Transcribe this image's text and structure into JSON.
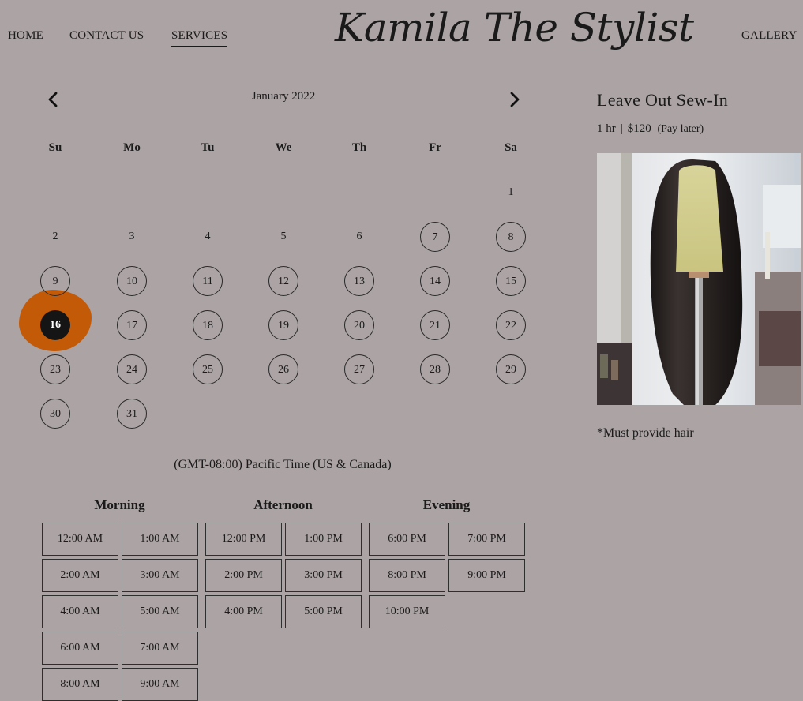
{
  "nav": {
    "home": "HOME",
    "contact": "CONTACT US",
    "services": "SERVICES",
    "gallery": "GALLERY",
    "logo": "Kamila The Stylist"
  },
  "calendar": {
    "month": "January 2022",
    "prev_icon": "chevron-left-icon",
    "next_icon": "chevron-right-icon",
    "weekdays": [
      "Su",
      "Mo",
      "Tu",
      "We",
      "Th",
      "Fr",
      "Sa"
    ],
    "days": [
      {
        "n": "1",
        "available": false
      },
      {
        "n": "2",
        "available": false
      },
      {
        "n": "3",
        "available": false
      },
      {
        "n": "4",
        "available": false
      },
      {
        "n": "5",
        "available": false
      },
      {
        "n": "6",
        "available": false
      },
      {
        "n": "7",
        "available": true
      },
      {
        "n": "8",
        "available": true
      },
      {
        "n": "9",
        "available": true
      },
      {
        "n": "10",
        "available": true
      },
      {
        "n": "11",
        "available": true
      },
      {
        "n": "12",
        "available": true
      },
      {
        "n": "13",
        "available": true
      },
      {
        "n": "14",
        "available": true
      },
      {
        "n": "15",
        "available": true
      },
      {
        "n": "16",
        "available": true,
        "selected": true
      },
      {
        "n": "17",
        "available": true
      },
      {
        "n": "18",
        "available": true
      },
      {
        "n": "19",
        "available": true
      },
      {
        "n": "20",
        "available": true
      },
      {
        "n": "21",
        "available": true
      },
      {
        "n": "22",
        "available": true
      },
      {
        "n": "23",
        "available": true
      },
      {
        "n": "24",
        "available": true
      },
      {
        "n": "25",
        "available": true
      },
      {
        "n": "26",
        "available": true
      },
      {
        "n": "27",
        "available": true
      },
      {
        "n": "28",
        "available": true
      },
      {
        "n": "29",
        "available": true
      },
      {
        "n": "30",
        "available": true
      },
      {
        "n": "31",
        "available": true
      }
    ],
    "first_weekday_index": 6,
    "highlight_color": "#c25a08"
  },
  "timezone": "(GMT-08:00) Pacific Time (US & Canada)",
  "periods": [
    {
      "name": "Morning",
      "slots": [
        "12:00 AM",
        "1:00 AM",
        "2:00 AM",
        "3:00 AM",
        "4:00 AM",
        "5:00 AM",
        "6:00 AM",
        "7:00 AM",
        "8:00 AM",
        "9:00 AM"
      ]
    },
    {
      "name": "Afternoon",
      "slots": [
        "12:00 PM",
        "1:00 PM",
        "2:00 PM",
        "3:00 PM",
        "4:00 PM",
        "5:00 PM"
      ]
    },
    {
      "name": "Evening",
      "slots": [
        "6:00 PM",
        "7:00 PM",
        "8:00 PM",
        "9:00 PM",
        "10:00 PM"
      ]
    }
  ],
  "service": {
    "title": "Leave Out Sew-In",
    "duration": "1 hr",
    "separator": "|",
    "price": "$120",
    "pay_note": "(Pay later)",
    "note": "*Must provide hair"
  }
}
